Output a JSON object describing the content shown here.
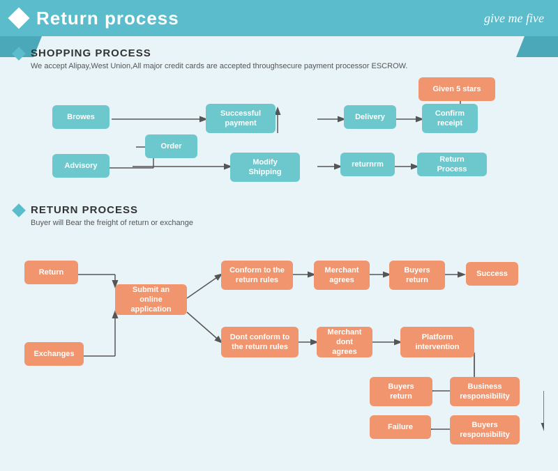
{
  "header": {
    "title": "Return process",
    "brand": "give me five"
  },
  "shopping": {
    "title": "SHOPPING PROCESS",
    "desc": "We accept Alipay,West Union,All major credit cards are accepted throughsecure payment processor ESCROW.",
    "nodes": {
      "browes": "Browes",
      "order": "Order",
      "advisory": "Advisory",
      "modify_shipping": "Modify\nShipping",
      "successful_payment": "Successful\npayment",
      "delivery": "Delivery",
      "confirm_receipt": "Confirm\nreceipt",
      "given_5_stars": "Given 5 stars",
      "returnrm": "returnrm",
      "return_process": "Return Process"
    }
  },
  "return": {
    "title": "RETURN PROCESS",
    "desc": "Buyer will Bear the freight of return or exchange",
    "nodes": {
      "return": "Return",
      "exchanges": "Exchanges",
      "submit_online": "Submit an online\napplication",
      "conform_rules": "Conform to the\nreturn rules",
      "dont_conform": "Dont conform to the\nreturn rules",
      "merchant_agrees": "Merchant\nagrees",
      "merchant_dont": "Merchant\ndont agrees",
      "buyers_return1": "Buyers\nreturn",
      "platform": "Platform\nintervention",
      "success": "Success",
      "buyers_return2": "Buyers\nreturn",
      "business_resp": "Business\nresponsibility",
      "failure": "Failure",
      "buyers_resp": "Buyers\nresponsibility"
    }
  }
}
